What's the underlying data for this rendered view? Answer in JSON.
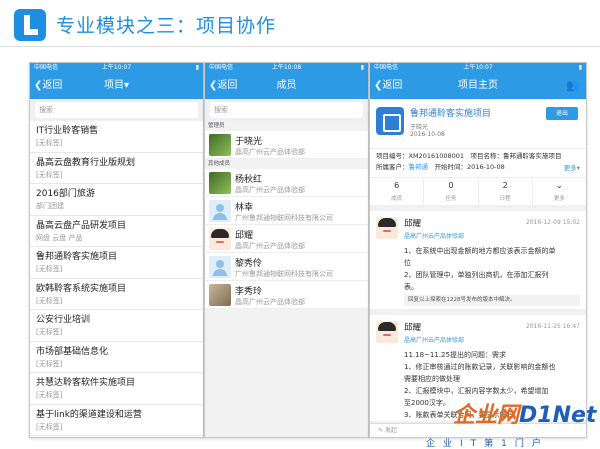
{
  "slide": {
    "title": "专业模块之三：项目协作"
  },
  "status_bar": {
    "carrier": "中国电信",
    "time_p1": "上午10:07",
    "time_p2": "上午10:08",
    "time_p3": "上午10:07"
  },
  "panel_projects": {
    "back": "返回",
    "title": "项目▾",
    "search_placeholder": "搜索",
    "items": [
      {
        "name": "IT行业聆客销售",
        "tag": "[无标签]"
      },
      {
        "name": "晶高云盘教育行业版规划",
        "tag": "[无标签]"
      },
      {
        "name": "2016部门旅游",
        "tag": "部门团建"
      },
      {
        "name": "晶高云盘产品研发项目",
        "tag": "网盘 云盘 产品"
      },
      {
        "name": "鲁邦通聆客实施项目",
        "tag": "[无标签]"
      },
      {
        "name": "欧韩聆客系统实施项目",
        "tag": "[无标签]"
      },
      {
        "name": "公安行业培训",
        "tag": "[无标签]"
      },
      {
        "name": "市场部基础信息化",
        "tag": "[无标签]"
      },
      {
        "name": "共慧达聆客软件实施项目",
        "tag": "[无标签]"
      },
      {
        "name": "基于link的渠道建设和运营",
        "tag": "[无标签]"
      }
    ]
  },
  "panel_members": {
    "back": "返回",
    "title": "成员",
    "search_placeholder": "搜索",
    "group_admin": "管理员",
    "group_other": "其他成员",
    "admins": [
      {
        "name": "于晓光",
        "org": "晶高广州云产品体验部"
      }
    ],
    "members": [
      {
        "name": "杨秋红",
        "org": "晶高广州云产品体验部"
      },
      {
        "name": "林幸",
        "org": "广州鲁邦通物联网科技有限公司"
      },
      {
        "name": "邱耀",
        "org": "晶高广州云产品体验部"
      },
      {
        "name": "黎秀伶",
        "org": "广州鲁邦通物联网科技有限公司"
      },
      {
        "name": "李秀玲",
        "org": "晶高广州云产品体验部"
      }
    ]
  },
  "panel_home": {
    "back": "返回",
    "title": "项目主页",
    "project_name": "鲁邦通聆客实施项目",
    "owner": "于晓光",
    "date": "2016-10-08",
    "button": "退出",
    "info_line1": "项目编号：XM20161008001　项目名称：鲁邦通聆客实施项目",
    "info_line2_prefix": "所属客户：",
    "info_line2_client": "鲁邦通",
    "info_line2_suffix": "　开始时间：2016-10-08",
    "more": "更多▾",
    "stats": [
      {
        "num": "6",
        "label": "成员"
      },
      {
        "num": "0",
        "label": "任务"
      },
      {
        "num": "2",
        "label": "日程"
      },
      {
        "num": "⌄",
        "label": "更多"
      }
    ],
    "posts": [
      {
        "name": "邱耀",
        "org": "晶高广州云产品体验部",
        "time": "2016-12-09 15:02",
        "lines": [
          "1、在系统中出现金额的地方都应该表示金额的单",
          "位",
          "2、团队管理中，单独列出商机，在添加汇报列",
          "表。"
        ],
        "quote": "回复以上探索在1228号发布的版本中解决。"
      },
      {
        "name": "邱耀",
        "org": "晶高广州云产品体验部",
        "time": "2016-11-25 16:47",
        "lines": [
          "11.18~11.25提出的问题：需求",
          "1、修正审核通过的账款记录，关联影响的金额也",
          "需要相应的做处理",
          "2、汇报模块中，汇报内容字数太少，希望增加",
          "至2000汉字。",
          "3、账款表单关联合同，要显示编码"
        ]
      }
    ],
    "bottom": "✎ 发起"
  },
  "watermark": {
    "brand": "企业网",
    "net": "D1Net",
    "footer": "企业IT第1门户"
  }
}
